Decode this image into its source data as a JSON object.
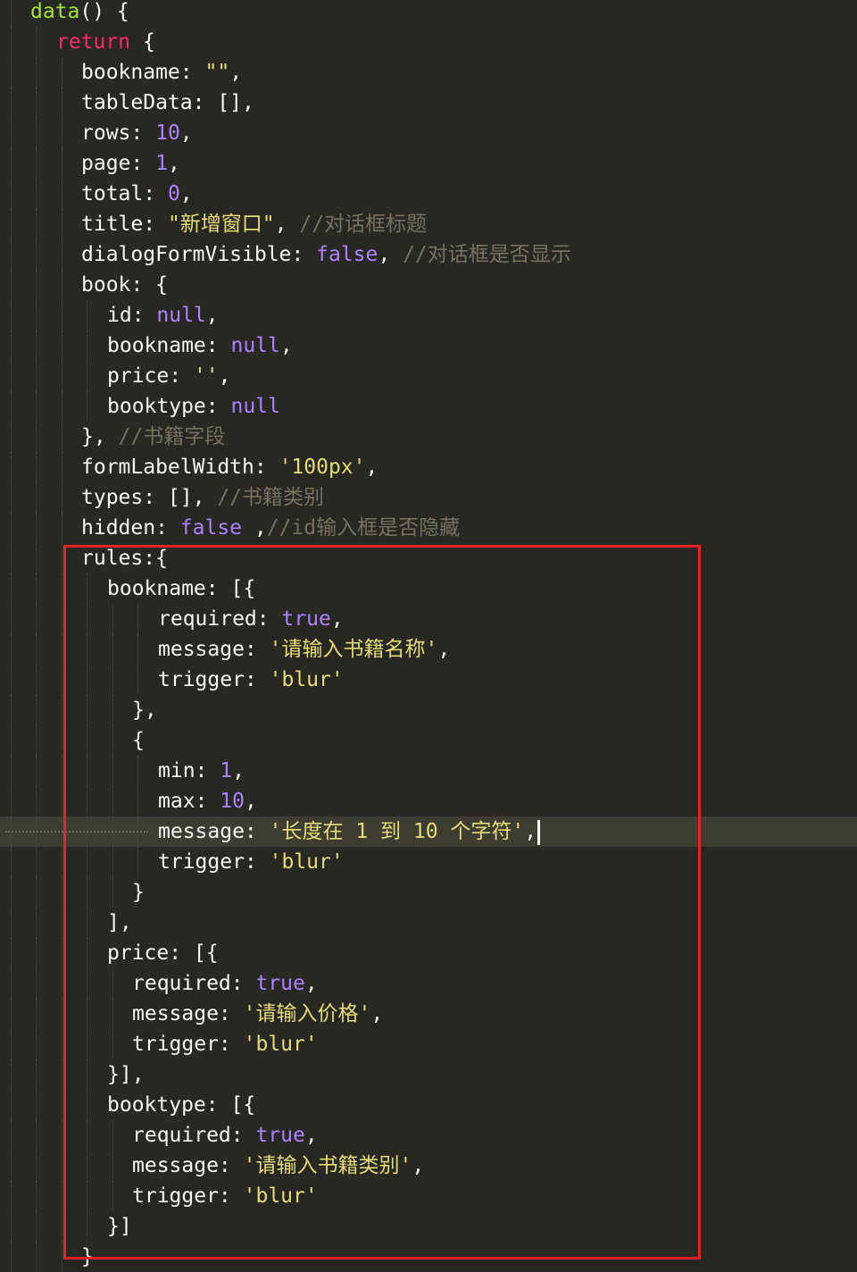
{
  "editor": {
    "lines": [
      {
        "indent": 1,
        "tokens": [
          [
            "f",
            "data"
          ],
          [
            "p",
            "() {"
          ]
        ]
      },
      {
        "indent": 2,
        "tokens": [
          [
            "k",
            "return"
          ],
          [
            "p",
            " {"
          ]
        ]
      },
      {
        "indent": 3,
        "tokens": [
          [
            "p",
            "bookname: "
          ],
          [
            "s",
            "\"\""
          ],
          [
            "p",
            ","
          ]
        ]
      },
      {
        "indent": 3,
        "tokens": [
          [
            "p",
            "tableData: [],"
          ]
        ]
      },
      {
        "indent": 3,
        "tokens": [
          [
            "p",
            "rows: "
          ],
          [
            "n",
            "10"
          ],
          [
            "p",
            ","
          ]
        ]
      },
      {
        "indent": 3,
        "tokens": [
          [
            "p",
            "page: "
          ],
          [
            "n",
            "1"
          ],
          [
            "p",
            ","
          ]
        ]
      },
      {
        "indent": 3,
        "tokens": [
          [
            "p",
            "total: "
          ],
          [
            "n",
            "0"
          ],
          [
            "p",
            ","
          ]
        ]
      },
      {
        "indent": 3,
        "tokens": [
          [
            "p",
            "title: "
          ],
          [
            "s",
            "\"新增窗口\""
          ],
          [
            "p",
            ", "
          ],
          [
            "c",
            "//对话框标题"
          ]
        ]
      },
      {
        "indent": 3,
        "tokens": [
          [
            "p",
            "dialogFormVisible: "
          ],
          [
            "n",
            "false"
          ],
          [
            "p",
            ", "
          ],
          [
            "c",
            "//对话框是否显示"
          ]
        ]
      },
      {
        "indent": 3,
        "tokens": [
          [
            "p",
            "book: {"
          ]
        ]
      },
      {
        "indent": 4,
        "tokens": [
          [
            "p",
            "id: "
          ],
          [
            "n",
            "null"
          ],
          [
            "p",
            ","
          ]
        ]
      },
      {
        "indent": 4,
        "tokens": [
          [
            "p",
            "bookname: "
          ],
          [
            "n",
            "null"
          ],
          [
            "p",
            ","
          ]
        ]
      },
      {
        "indent": 4,
        "tokens": [
          [
            "p",
            "price: "
          ],
          [
            "s",
            "''"
          ],
          [
            "p",
            ","
          ]
        ]
      },
      {
        "indent": 4,
        "tokens": [
          [
            "p",
            "booktype: "
          ],
          [
            "n",
            "null"
          ]
        ]
      },
      {
        "indent": 3,
        "tokens": [
          [
            "p",
            "}, "
          ],
          [
            "c",
            "//书籍字段"
          ]
        ]
      },
      {
        "indent": 3,
        "tokens": [
          [
            "p",
            "formLabelWidth: "
          ],
          [
            "s",
            "'100px'"
          ],
          [
            "p",
            ","
          ]
        ]
      },
      {
        "indent": 3,
        "tokens": [
          [
            "p",
            "types: [], "
          ],
          [
            "c",
            "//书籍类别"
          ]
        ]
      },
      {
        "indent": 3,
        "tokens": [
          [
            "p",
            "hidden: "
          ],
          [
            "n",
            "false"
          ],
          [
            "p",
            " ,"
          ],
          [
            "c",
            "//id输入框是否隐藏"
          ]
        ]
      },
      {
        "indent": 3,
        "tokens": [
          [
            "p",
            "rules:{"
          ]
        ]
      },
      {
        "indent": 4,
        "tokens": [
          [
            "p",
            "bookname: [{"
          ]
        ]
      },
      {
        "indent": 6,
        "tokens": [
          [
            "p",
            "required: "
          ],
          [
            "n",
            "true"
          ],
          [
            "p",
            ","
          ]
        ]
      },
      {
        "indent": 6,
        "tokens": [
          [
            "p",
            "message: "
          ],
          [
            "s",
            "'请输入书籍名称'"
          ],
          [
            "p",
            ","
          ]
        ]
      },
      {
        "indent": 6,
        "tokens": [
          [
            "p",
            "trigger: "
          ],
          [
            "s",
            "'blur'"
          ]
        ]
      },
      {
        "indent": 5,
        "tokens": [
          [
            "p",
            "},"
          ]
        ]
      },
      {
        "indent": 5,
        "tokens": [
          [
            "p",
            "{"
          ]
        ]
      },
      {
        "indent": 6,
        "tokens": [
          [
            "p",
            "min: "
          ],
          [
            "n",
            "1"
          ],
          [
            "p",
            ","
          ]
        ]
      },
      {
        "indent": 6,
        "tokens": [
          [
            "p",
            "max: "
          ],
          [
            "n",
            "10"
          ],
          [
            "p",
            ","
          ]
        ]
      },
      {
        "indent": 6,
        "active": true,
        "tokens": [
          [
            "p",
            "message: "
          ],
          [
            "s",
            "'长度在 1 到 10 个字符'"
          ],
          [
            "p",
            ","
          ]
        ]
      },
      {
        "indent": 6,
        "tokens": [
          [
            "p",
            "trigger: "
          ],
          [
            "s",
            "'blur'"
          ]
        ]
      },
      {
        "indent": 5,
        "tokens": [
          [
            "p",
            "}"
          ]
        ]
      },
      {
        "indent": 4,
        "tokens": [
          [
            "p",
            "],"
          ]
        ]
      },
      {
        "indent": 4,
        "tokens": [
          [
            "p",
            "price: [{"
          ]
        ]
      },
      {
        "indent": 5,
        "tokens": [
          [
            "p",
            "required: "
          ],
          [
            "n",
            "true"
          ],
          [
            "p",
            ","
          ]
        ]
      },
      {
        "indent": 5,
        "tokens": [
          [
            "p",
            "message: "
          ],
          [
            "s",
            "'请输入价格'"
          ],
          [
            "p",
            ","
          ]
        ]
      },
      {
        "indent": 5,
        "tokens": [
          [
            "p",
            "trigger: "
          ],
          [
            "s",
            "'blur'"
          ]
        ]
      },
      {
        "indent": 4,
        "tokens": [
          [
            "p",
            "}],"
          ]
        ]
      },
      {
        "indent": 4,
        "tokens": [
          [
            "p",
            "booktype: [{"
          ]
        ]
      },
      {
        "indent": 5,
        "tokens": [
          [
            "p",
            "required: "
          ],
          [
            "n",
            "true"
          ],
          [
            "p",
            ","
          ]
        ]
      },
      {
        "indent": 5,
        "tokens": [
          [
            "p",
            "message: "
          ],
          [
            "s",
            "'请输入书籍类别'"
          ],
          [
            "p",
            ","
          ]
        ]
      },
      {
        "indent": 5,
        "tokens": [
          [
            "p",
            "trigger: "
          ],
          [
            "s",
            "'blur'"
          ]
        ]
      },
      {
        "indent": 4,
        "tokens": [
          [
            "p",
            "}]"
          ]
        ]
      },
      {
        "indent": 3,
        "tokens": [
          [
            "p",
            "}"
          ]
        ]
      }
    ]
  },
  "colors": {
    "background": "#272822",
    "keyword": "#f92672",
    "function": "#a6e22e",
    "number": "#ae81ff",
    "string": "#e6db74",
    "comment": "#75715e",
    "plain": "#f8f8f2",
    "highlight_box": "#e8202a"
  }
}
